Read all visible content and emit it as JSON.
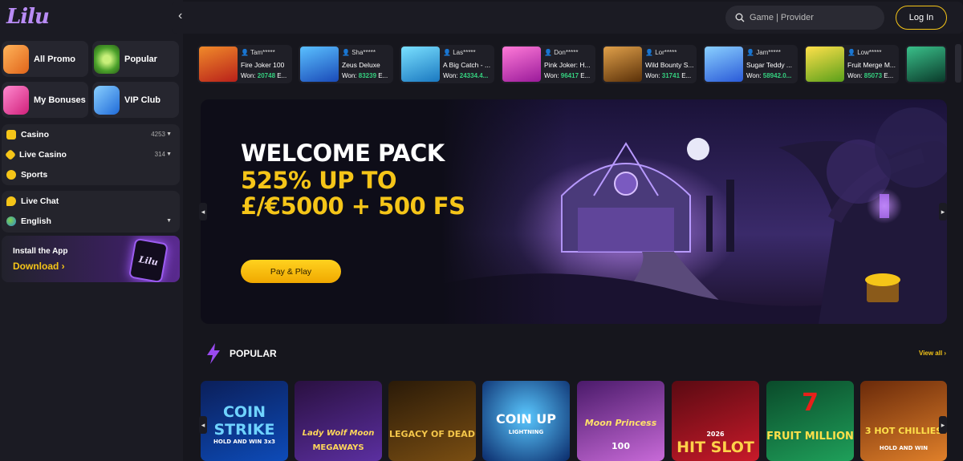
{
  "brand": {
    "logo": "Lilu"
  },
  "sidebar": {
    "promos": [
      {
        "label": "All Promo",
        "icon": "rocket-icon",
        "color": "#f08c3a"
      },
      {
        "label": "Popular",
        "icon": "roulette-icon",
        "color": "#7fd14a"
      },
      {
        "label": "My Bonuses",
        "icon": "shopping-bag-icon",
        "color": "#ff4fa8"
      },
      {
        "label": "VIP Club",
        "icon": "gift-icon",
        "color": "#3a9cf5"
      }
    ],
    "categories": [
      {
        "label": "Casino",
        "count": "4253",
        "icon": "dice-icon"
      },
      {
        "label": "Live Casino",
        "count": "314",
        "icon": "chip-icon"
      },
      {
        "label": "Sports",
        "count": "",
        "icon": "ball-icon"
      }
    ],
    "extras": [
      {
        "label": "Live Chat",
        "icon": "chat-icon"
      },
      {
        "label": "English",
        "icon": "globe-icon"
      }
    ],
    "install": {
      "title": "Install the App",
      "cta": "Download ›",
      "phone_text": "Lilu"
    }
  },
  "header": {
    "back_icon": "‹",
    "search_placeholder": "Game | Provider",
    "login_label": "Log In"
  },
  "winners": [
    {
      "user": "Tam*****",
      "game": "Fire Joker 100",
      "won_label": "Won:",
      "amount": "20748",
      "cur": "E...",
      "color": "#d8452b"
    },
    {
      "user": "Sha*****",
      "game": "Zeus Deluxe",
      "won_label": "Won:",
      "amount": "83239",
      "cur": "E...",
      "color": "#2a6fd1"
    },
    {
      "user": "Las*****",
      "game": "A Big Catch - ...",
      "won_label": "Won:",
      "amount": "24334.4...",
      "cur": "",
      "color": "#2aa3d8"
    },
    {
      "user": "Don*****",
      "game": "Pink Joker: H...",
      "won_label": "Won:",
      "amount": "96417",
      "cur": "E...",
      "color": "#d63ab0"
    },
    {
      "user": "Lor*****",
      "game": "Wild Bounty S...",
      "won_label": "Won:",
      "amount": "31741",
      "cur": "E...",
      "color": "#a86a1f"
    },
    {
      "user": "Jam*****",
      "game": "Sugar Teddy ...",
      "won_label": "Won:",
      "amount": "58942.0...",
      "cur": "",
      "color": "#4a8ff0"
    },
    {
      "user": "Low*****",
      "game": "Fruit Merge M...",
      "won_label": "Won:",
      "amount": "85073",
      "cur": "E...",
      "color": "#e2c21a"
    },
    {
      "user": "",
      "game": "",
      "won_label": "",
      "amount": "",
      "cur": "",
      "color": "#1f6b4a"
    }
  ],
  "hero": {
    "line1": "WELCOME PACK",
    "line2": "525% UP TO",
    "line3": "£/€5000 + 500 FS",
    "cta": "Pay & Play"
  },
  "popular": {
    "title": "POPULAR",
    "view_all": "View all ›",
    "games": [
      {
        "name": "COIN STRIKE",
        "sub": "HOLD AND WIN 3x3",
        "bg1": "#0b1f5a",
        "bg2": "#0d4bb8",
        "fg": "#6fd3ff"
      },
      {
        "name": "Lady Wolf Moon",
        "sub": "MEGAWAYS",
        "bg1": "#2a1040",
        "bg2": "#5b2fa0",
        "fg": "#ffd75a"
      },
      {
        "name": "LEGACY OF DEAD",
        "sub": "",
        "bg1": "#2a1a08",
        "bg2": "#7a4e12",
        "fg": "#f4c64a"
      },
      {
        "name": "COIN UP",
        "sub": "LIGHTNING",
        "bg1": "#0a2a6a",
        "bg2": "#1f7ae0",
        "fg": "#ffffff"
      },
      {
        "name": "Moon Princess",
        "sub": "100",
        "bg1": "#4a1a6a",
        "bg2": "#c86ad8",
        "fg": "#ffe06a"
      },
      {
        "name": "HIT SLOT",
        "sub": "2026",
        "bg1": "#5a0a12",
        "bg2": "#c81a2a",
        "fg": "#ffd24a"
      },
      {
        "name": "FRUIT MILLION",
        "sub": "",
        "bg1": "#0a4a2a",
        "bg2": "#1fa05a",
        "fg": "#ffe04a"
      },
      {
        "name": "3 HOT CHILLIES",
        "sub": "HOLD AND WIN",
        "bg1": "#6a2a0a",
        "bg2": "#e0802a",
        "fg": "#ffe04a"
      }
    ]
  }
}
